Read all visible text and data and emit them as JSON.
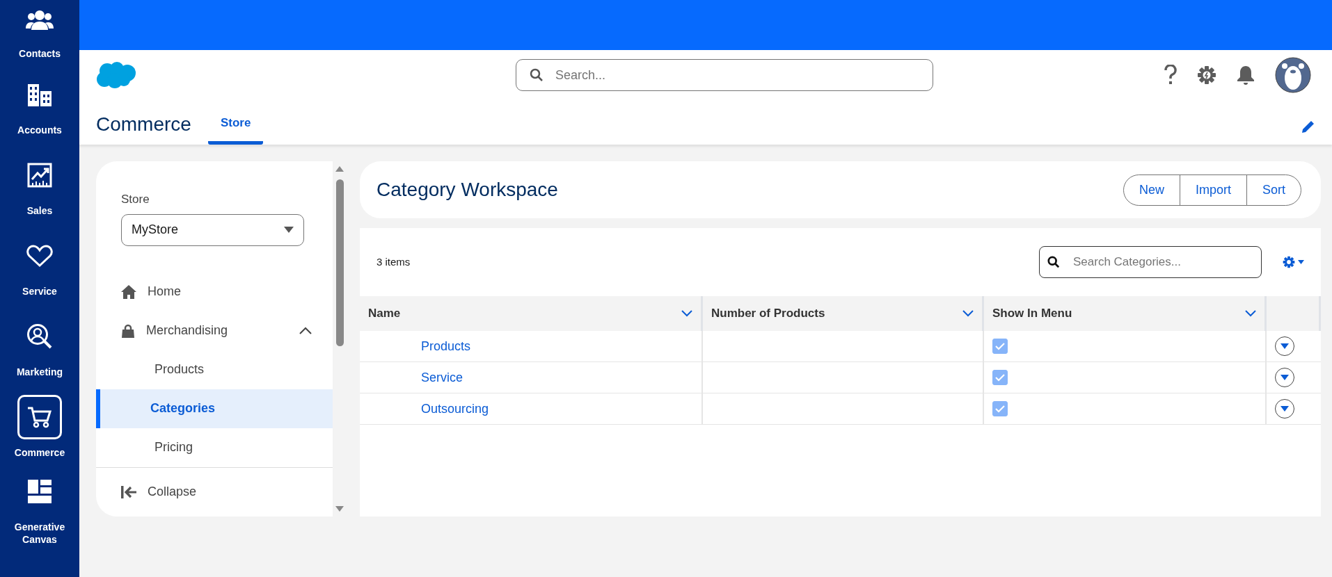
{
  "app_rail": {
    "items": [
      {
        "label": "Contacts",
        "selected": false
      },
      {
        "label": "Accounts",
        "selected": false
      },
      {
        "label": "Sales",
        "selected": false
      },
      {
        "label": "Service",
        "selected": false
      },
      {
        "label": "Marketing",
        "selected": false
      },
      {
        "label": "Commerce",
        "selected": true
      },
      {
        "label": "Generative Canvas",
        "selected": false
      }
    ]
  },
  "header": {
    "search": {
      "placeholder": "Search..."
    }
  },
  "app_bar": {
    "app_name": "Commerce",
    "tabs": [
      {
        "label": "Store",
        "selected": true
      }
    ]
  },
  "side_panel": {
    "store_label": "Store",
    "store_select": "MyStore",
    "nav": [
      {
        "label": "Home",
        "kind": "home",
        "selected": false
      },
      {
        "label": "Merchandising",
        "kind": "group",
        "expanded": true,
        "selected": false,
        "children": [
          {
            "label": "Products",
            "selected": false
          },
          {
            "label": "Categories",
            "selected": true
          },
          {
            "label": "Pricing",
            "selected": false
          }
        ]
      }
    ],
    "collapse": "Collapse"
  },
  "workspace": {
    "title": "Category Workspace",
    "buttons": [
      "New",
      "Import",
      "Sort"
    ]
  },
  "table": {
    "count": "3 items",
    "search": {
      "placeholder": "Search Categories..."
    },
    "columns": [
      "Name",
      "Number of Products",
      "Show In Menu"
    ],
    "rows": [
      {
        "name": "Products",
        "number_of_products": "",
        "show_in_menu": true
      },
      {
        "name": "Service",
        "number_of_products": "",
        "show_in_menu": true
      },
      {
        "name": "Outsourcing",
        "number_of_products": "",
        "show_in_menu": true
      }
    ]
  }
}
